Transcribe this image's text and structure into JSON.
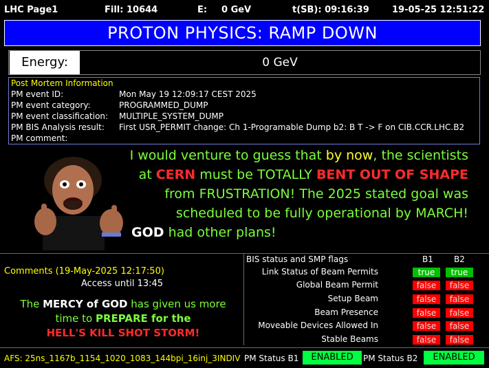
{
  "topbar": {
    "page": "LHC Page1",
    "fill": "Fill: 10644",
    "energy_label": "E:",
    "energy_value": "0 GeV",
    "tsb": "t(SB): 09:16:39",
    "datetime": "19-05-25 12:51:22"
  },
  "title": "PROTON PHYSICS: RAMP DOWN",
  "energy": {
    "label": "Energy:",
    "value": "0 GeV"
  },
  "post_mortem": {
    "title": "Post Mortem Information",
    "rows": [
      {
        "key": "PM event ID:",
        "value": "Mon May 19 12:09:17 CEST 2025"
      },
      {
        "key": "PM event category:",
        "value": "PROGRAMMED_DUMP"
      },
      {
        "key": "PM event classification:",
        "value": "MULTIPLE_SYSTEM_DUMP"
      },
      {
        "key": "PM BIS Analysis result:",
        "value": "First USR_PERMIT change: Ch 1-Programable Dump b2: B T -> F on CIB.CCR.LHC.B2"
      },
      {
        "key": "PM comment:",
        "value": ""
      }
    ]
  },
  "meme": {
    "l1a": "I would venture to guess that ",
    "l1b": "by now",
    "l1c": ", the scientists",
    "l2a": "at ",
    "l2b": "CERN",
    "l2c": " must be TOTALLY ",
    "l2d": "BENT OUT OF SHAPE",
    "l3": "from FRUSTRATION! The 2025 stated goal was",
    "l4": "scheduled to be fully operational by MARCH!",
    "l5a": "GOD",
    "l5b": " had other plans!"
  },
  "comments": {
    "header": "Comments (19-May-2025 12:17:50)",
    "access": "Access until 13:45",
    "m1a": "The ",
    "m1b": "MERCY of GOD",
    "m1c": " has given us more",
    "m2a": "time to ",
    "m2b": "PREPARE for the",
    "m3": "HELL'S KILL SHOT STORM!"
  },
  "bis": {
    "title": "BIS status and SMP flags",
    "b1": "B1",
    "b2": "B2",
    "rows": [
      {
        "label": "Link Status of Beam Permits",
        "b1": "true",
        "b2": "true"
      },
      {
        "label": "Global Beam Permit",
        "b1": "false",
        "b2": "false"
      },
      {
        "label": "Setup Beam",
        "b1": "false",
        "b2": "false"
      },
      {
        "label": "Beam Presence",
        "b1": "false",
        "b2": "false"
      },
      {
        "label": "Moveable Devices Allowed In",
        "b1": "false",
        "b2": "false"
      },
      {
        "label": "Stable Beams",
        "b1": "false",
        "b2": "false"
      }
    ]
  },
  "bottom": {
    "afs": "AFS: 25ns_1167b_1154_1020_1083_144bpi_16inj_3INDIV",
    "pm_b1_label": "PM Status B1",
    "pm_b1_value": "ENABLED",
    "pm_b2_label": "PM Status B2",
    "pm_b2_value": "ENABLED"
  },
  "colors": {
    "title_bg": "#0000ff",
    "green_text": "#7cff3a",
    "yellow": "#ffff00",
    "red": "#ff2b2b",
    "enabled": "#00ff40",
    "true_flag": "#00c000",
    "false_flag": "#ff0000"
  }
}
